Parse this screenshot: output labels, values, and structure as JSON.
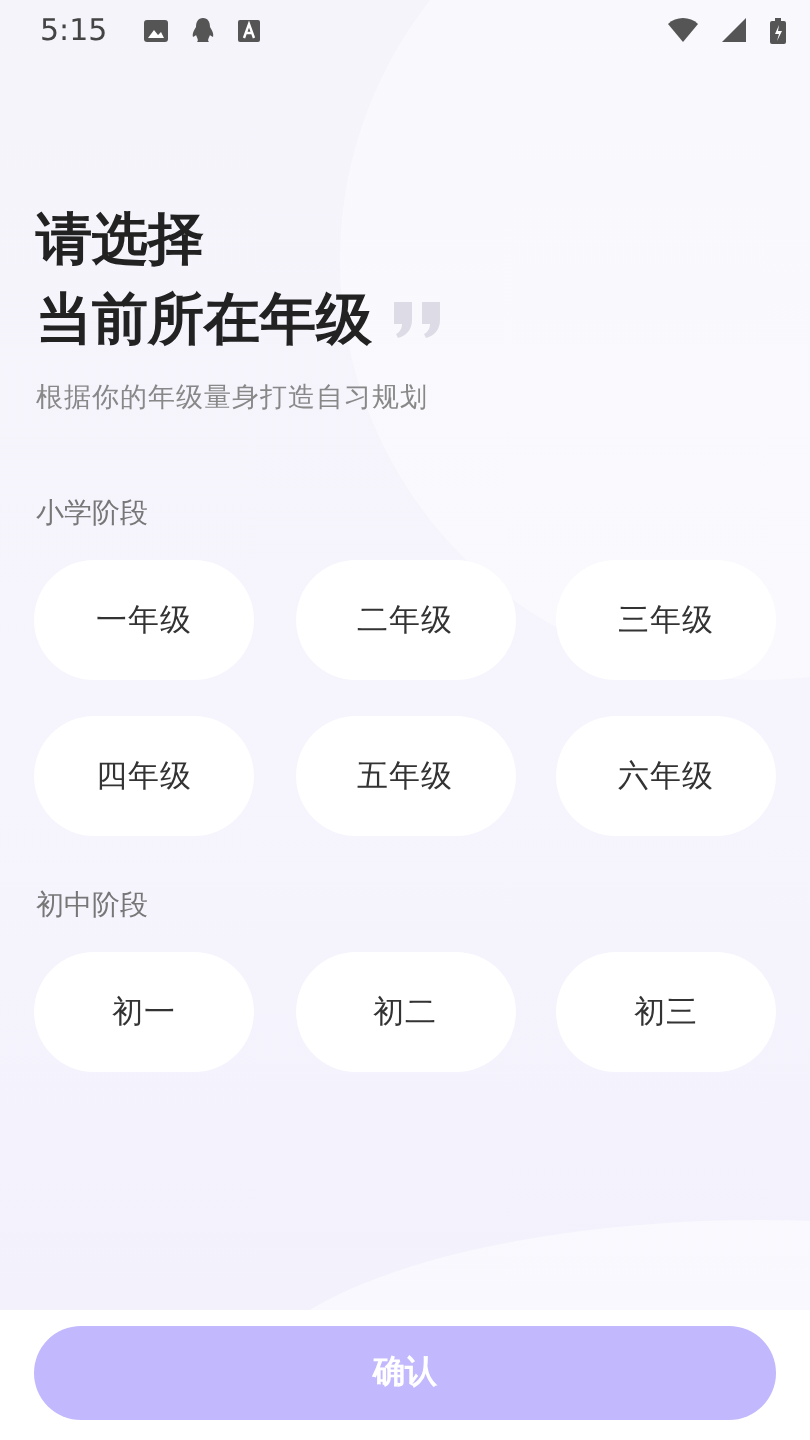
{
  "status_bar": {
    "time": "5:15"
  },
  "heading": {
    "lines": [
      "请选择",
      "当前所在年级"
    ],
    "subtitle": "根据你的年级量身打造自习规划"
  },
  "sections": [
    {
      "title": "小学阶段",
      "options": [
        {
          "label": "一年级",
          "selected": false
        },
        {
          "label": "二年级",
          "selected": false
        },
        {
          "label": "三年级",
          "selected": false
        },
        {
          "label": "四年级",
          "selected": false
        },
        {
          "label": "五年级",
          "selected": false
        },
        {
          "label": "六年级",
          "selected": false
        }
      ]
    },
    {
      "title": "初中阶段",
      "options": [
        {
          "label": "初一",
          "selected": false
        },
        {
          "label": "初二",
          "selected": false
        },
        {
          "label": "初三",
          "selected": false
        }
      ]
    }
  ],
  "confirm_button": {
    "label": "确认",
    "disabled": true
  }
}
